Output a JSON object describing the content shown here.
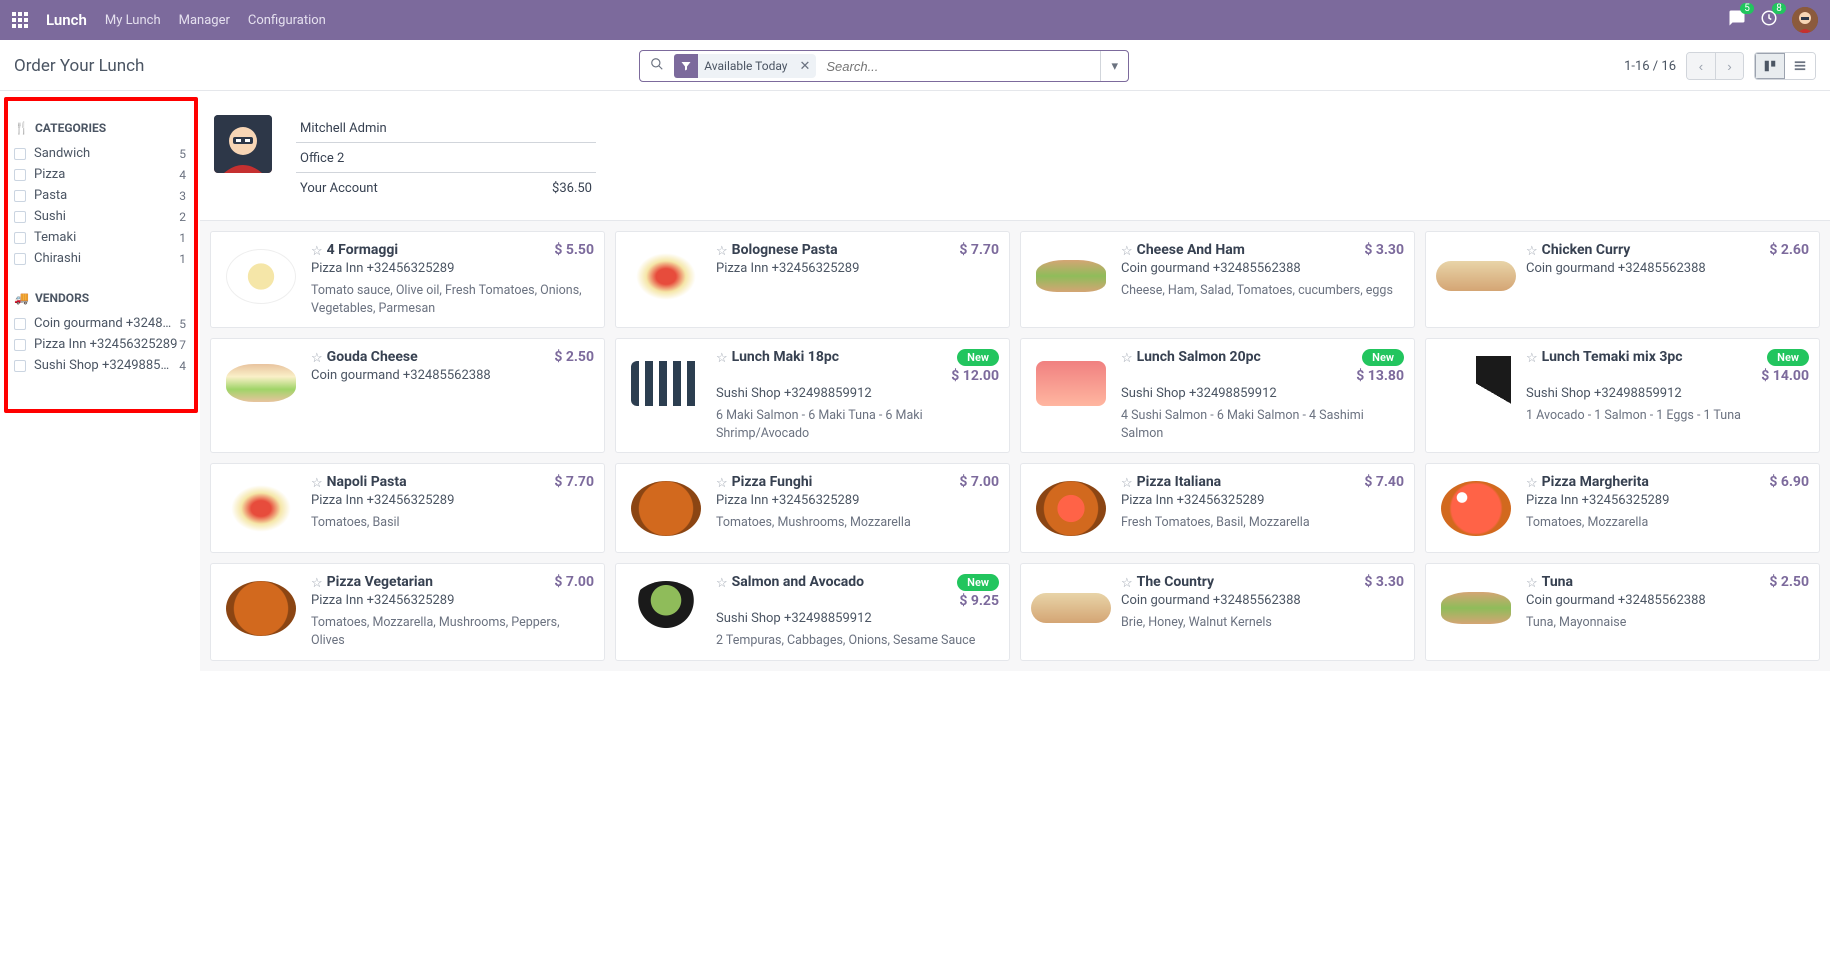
{
  "nav": {
    "brand": "Lunch",
    "links": [
      "My Lunch",
      "Manager",
      "Configuration"
    ],
    "chat_badge": "5",
    "activity_badge": "8"
  },
  "header": {
    "title": "Order Your Lunch",
    "filter_label": "Available Today",
    "search_placeholder": "Search...",
    "pager": "1-16 / 16"
  },
  "sidebar": {
    "cat_title": "CATEGORIES",
    "categories": [
      {
        "label": "Sandwich",
        "count": "5"
      },
      {
        "label": "Pizza",
        "count": "4"
      },
      {
        "label": "Pasta",
        "count": "3"
      },
      {
        "label": "Sushi",
        "count": "2"
      },
      {
        "label": "Temaki",
        "count": "1"
      },
      {
        "label": "Chirashi",
        "count": "1"
      }
    ],
    "ven_title": "VENDORS",
    "vendors": [
      {
        "label": "Coin gourmand +3248…",
        "count": "5"
      },
      {
        "label": "Pizza Inn +32456325289",
        "count": "7"
      },
      {
        "label": "Sushi Shop +3249885…",
        "count": "4"
      }
    ]
  },
  "user": {
    "name": "Mitchell Admin",
    "office": "Office 2",
    "account_label": "Your Account",
    "balance": "$36.50"
  },
  "products": [
    {
      "name": "4 Formaggi",
      "price": "$ 5.50",
      "vendor": "Pizza Inn +32456325289",
      "desc": "Tomato sauce, Olive oil, Fresh Tomatoes, Onions, Vegetables, Parmesan",
      "img": "pasta",
      "new": false
    },
    {
      "name": "Bolognese Pasta",
      "price": "$ 7.70",
      "vendor": "Pizza Inn +32456325289",
      "desc": "",
      "img": "pasta2",
      "new": false
    },
    {
      "name": "Cheese And Ham",
      "price": "$ 3.30",
      "vendor": "Coin gourmand +32485562388",
      "desc": "Cheese, Ham, Salad, Tomatoes, cucumbers, eggs",
      "img": "sandwich",
      "new": false
    },
    {
      "name": "Chicken Curry",
      "price": "$ 2.60",
      "vendor": "Coin gourmand +32485562388",
      "desc": "",
      "img": "longsand",
      "new": false
    },
    {
      "name": "Gouda Cheese",
      "price": "$ 2.50",
      "vendor": "Coin gourmand +32485562388",
      "desc": "",
      "img": "sandwich2",
      "new": false
    },
    {
      "name": "Lunch Maki 18pc",
      "price": "$ 12.00",
      "vendor": "Sushi Shop +32498859912",
      "desc": "6 Maki Salmon - 6 Maki Tuna - 6 Maki Shrimp/Avocado",
      "img": "sushi",
      "new": true
    },
    {
      "name": "Lunch Salmon 20pc",
      "price": "$ 13.80",
      "vendor": "Sushi Shop +32498859912",
      "desc": "4 Sushi Salmon - 6 Maki Salmon - 4 Sashimi Salmon",
      "img": "salmon",
      "new": true
    },
    {
      "name": "Lunch Temaki mix 3pc",
      "price": "$ 14.00",
      "vendor": "Sushi Shop +32498859912",
      "desc": "1 Avocado - 1 Salmon - 1 Eggs - 1 Tuna",
      "img": "temaki",
      "new": true
    },
    {
      "name": "Napoli Pasta",
      "price": "$ 7.70",
      "vendor": "Pizza Inn +32456325289",
      "desc": "Tomatoes, Basil",
      "img": "pasta2",
      "new": false
    },
    {
      "name": "Pizza Funghi",
      "price": "$ 7.00",
      "vendor": "Pizza Inn +32456325289",
      "desc": "Tomatoes, Mushrooms, Mozzarella",
      "img": "pizza",
      "new": false
    },
    {
      "name": "Pizza Italiana",
      "price": "$ 7.40",
      "vendor": "Pizza Inn +32456325289",
      "desc": "Fresh Tomatoes, Basil, Mozzarella",
      "img": "pizza2",
      "new": false
    },
    {
      "name": "Pizza Margherita",
      "price": "$ 6.90",
      "vendor": "Pizza Inn +32456325289",
      "desc": "Tomatoes, Mozzarella",
      "img": "pizzaM",
      "new": false
    },
    {
      "name": "Pizza Vegetarian",
      "price": "$ 7.00",
      "vendor": "Pizza Inn +32456325289",
      "desc": "Tomatoes, Mozzarella, Mushrooms, Peppers, Olives",
      "img": "pizza",
      "new": false
    },
    {
      "name": "Salmon and Avocado",
      "price": "$ 9.25",
      "vendor": "Sushi Shop +32498859912",
      "desc": "2 Tempuras, Cabbages, Onions, Sesame Sauce",
      "img": "bowl",
      "new": true
    },
    {
      "name": "The Country",
      "price": "$ 3.30",
      "vendor": "Coin gourmand +32485562388",
      "desc": "Brie, Honey, Walnut Kernels",
      "img": "longsand",
      "new": false
    },
    {
      "name": "Tuna",
      "price": "$ 2.50",
      "vendor": "Coin gourmand +32485562388",
      "desc": "Tuna, Mayonnaise",
      "img": "sandwich",
      "new": false
    }
  ],
  "labels": {
    "new": "New"
  }
}
